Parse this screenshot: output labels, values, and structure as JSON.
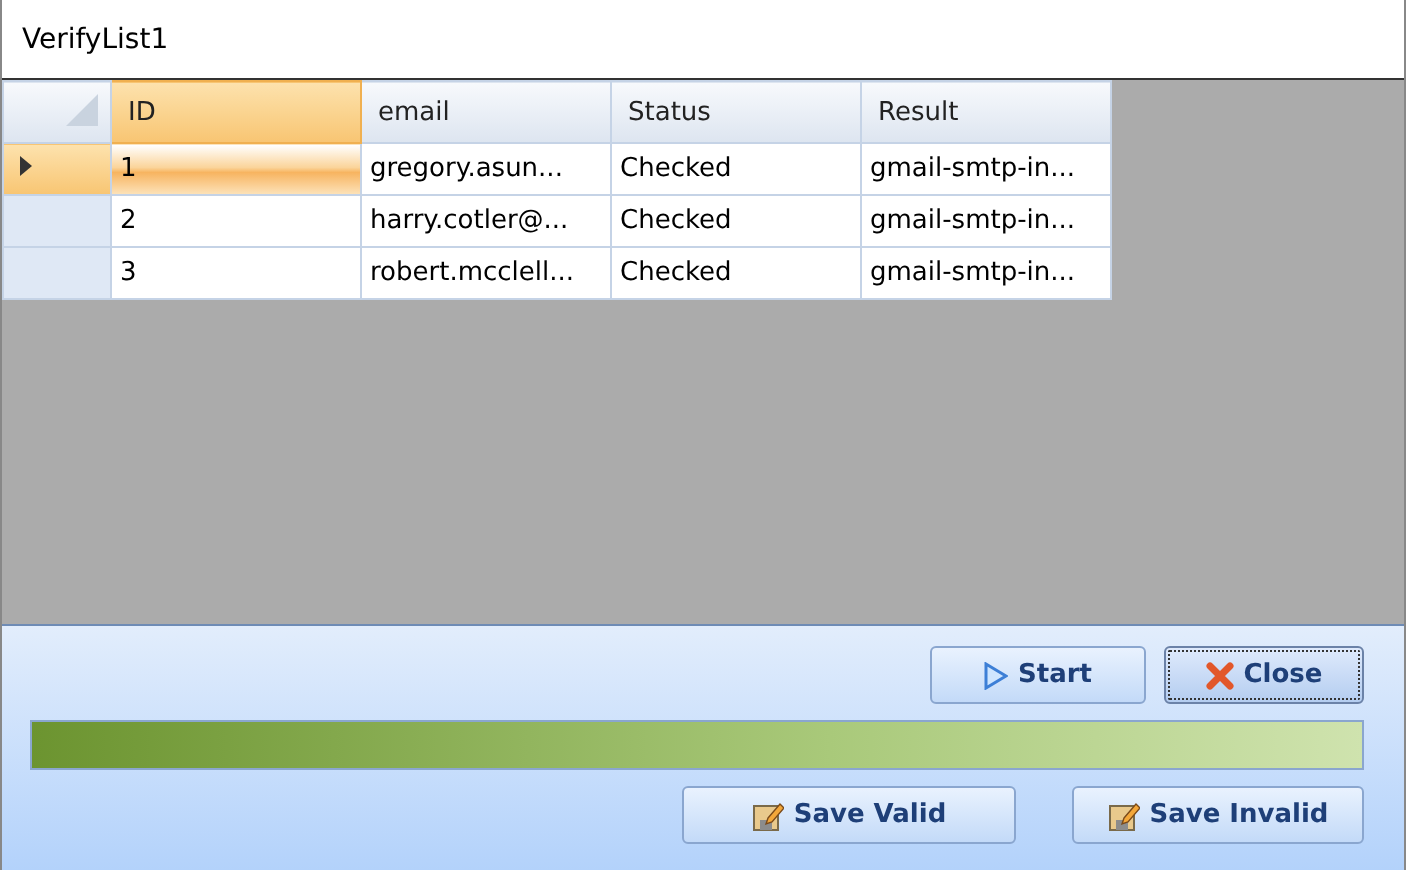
{
  "window": {
    "title": "VerifyList1"
  },
  "table": {
    "columns": [
      {
        "label": "ID",
        "selected": true
      },
      {
        "label": "email",
        "selected": false
      },
      {
        "label": "Status",
        "selected": false
      },
      {
        "label": "Result",
        "selected": false
      }
    ],
    "rows": [
      {
        "selected": true,
        "cells": [
          "1",
          "gregory.asun...",
          "Checked",
          "gmail-smtp-in..."
        ]
      },
      {
        "selected": false,
        "cells": [
          "2",
          "harry.cotler@...",
          "Checked",
          "gmail-smtp-in..."
        ]
      },
      {
        "selected": false,
        "cells": [
          "3",
          "robert.mcclell...",
          "Checked",
          "gmail-smtp-in..."
        ]
      }
    ]
  },
  "top_buttons": [
    {
      "label": "Start",
      "kind": "play",
      "focused": false
    },
    {
      "label": "Close",
      "kind": "close",
      "focused": true
    }
  ],
  "progress": {
    "level": 1
  },
  "bottom_buttons": [
    {
      "label": "Save Valid",
      "kind": "save",
      "focused": false
    },
    {
      "label": "Save Invalid",
      "kind": "save",
      "focused": false
    }
  ]
}
